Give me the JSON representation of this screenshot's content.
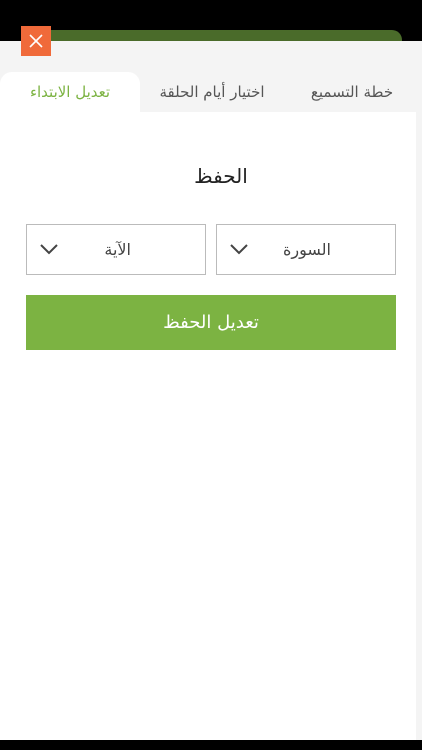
{
  "close": {
    "icon": "close-icon"
  },
  "tabs": [
    {
      "label": "خطة التسميع",
      "active": false
    },
    {
      "label": "اختيار أيام الحلقة",
      "active": false
    },
    {
      "label": "تعديل الابتداء",
      "active": true
    }
  ],
  "section": {
    "title": "الحفظ"
  },
  "selects": {
    "surah": {
      "label": "السورة",
      "icon": "chevron-down-icon"
    },
    "ayah": {
      "label": "الآية",
      "icon": "chevron-down-icon"
    }
  },
  "action": {
    "label": "تعديل الحفظ"
  },
  "colors": {
    "accent": "#7cb342",
    "close": "#f06a3a",
    "text": "#555555"
  }
}
